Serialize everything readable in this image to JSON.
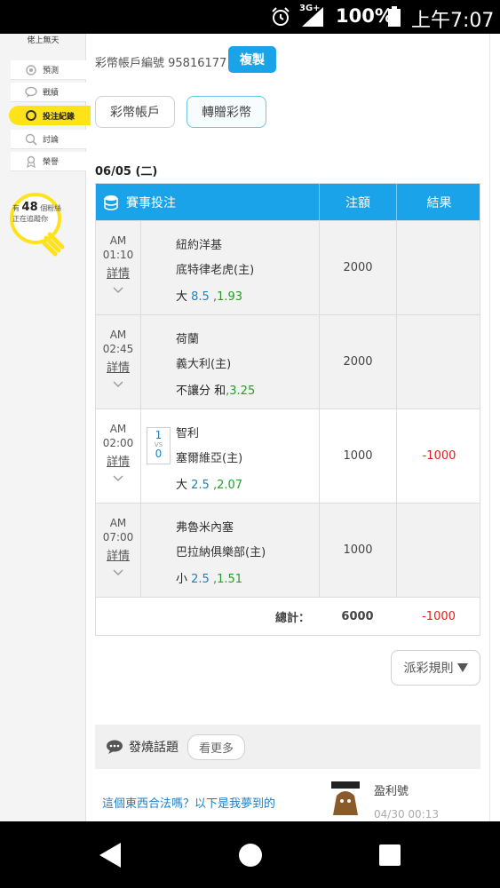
{
  "statusbar": {
    "network": "3G+",
    "battery": "100%",
    "time": "上午7:07"
  },
  "sidebar": {
    "top_label": "佬上無天",
    "items": [
      {
        "label": "預測",
        "icon": "target-icon"
      },
      {
        "label": "戰績",
        "icon": "chat-icon"
      },
      {
        "label": "投注紀錄",
        "icon": "circle-icon",
        "active": true
      },
      {
        "label": "討論",
        "icon": "magnifier-icon"
      },
      {
        "label": "榮譽",
        "icon": "medal-icon"
      }
    ],
    "followers": {
      "prefix": "有",
      "count": "48",
      "suffix": "個粉絲",
      "line2": "正在追蹤你"
    }
  },
  "account": {
    "label": "彩幣帳戶編號 95816177",
    "copy_label": "複製"
  },
  "tabs": {
    "wallet": "彩幣帳戶",
    "transfer": "轉贈彩幣"
  },
  "date": "06/05 (二)",
  "table": {
    "header": {
      "event": "賽事投注",
      "amount": "注額",
      "result": "結果"
    },
    "detail_label": "詳情",
    "rows": [
      {
        "ampm": "AM",
        "time": "01:10",
        "away": "紐約洋基",
        "home": "底特律老虎(主)",
        "bet_prefix": "大",
        "bet_line": "8.5",
        "bet_odds": ",1.93",
        "amount": "2000",
        "result": ""
      },
      {
        "ampm": "AM",
        "time": "02:45",
        "away": "荷蘭",
        "home": "義大利(主)",
        "bet_prefix": "不讓分 和",
        "bet_line": "",
        "bet_odds": ",3.25",
        "amount": "2000",
        "result": ""
      },
      {
        "ampm": "AM",
        "time": "02:00",
        "away": "智利",
        "home": "塞爾維亞(主)",
        "bet_prefix": "大",
        "bet_line": "2.5",
        "bet_odds": ",2.07",
        "amount": "1000",
        "result": "-1000",
        "score_away": "1",
        "score_vs": "VS",
        "score_home": "0"
      },
      {
        "ampm": "AM",
        "time": "07:00",
        "away": "弗魯米內塞",
        "home": "巴拉納俱樂部(主)",
        "bet_prefix": "小",
        "bet_line": "2.5",
        "bet_odds": ",1.51",
        "amount": "1000",
        "result": ""
      }
    ],
    "total": {
      "label": "總計：",
      "amount": "6000",
      "result": "-1000"
    }
  },
  "rules_button": "派彩規則",
  "hot_topics": {
    "title": "發燒話題",
    "see_more": "看更多",
    "topic": "這個東西合法嗎？以下是我夢到的",
    "poster": "盈利號",
    "posted_at": "04/30 00:13"
  },
  "colors": {
    "accent": "#1aa3e8",
    "active_menu": "#ffe31a",
    "loss": "#e0201a",
    "odds": "#2a9a2a",
    "line": "#1f7fc4"
  }
}
